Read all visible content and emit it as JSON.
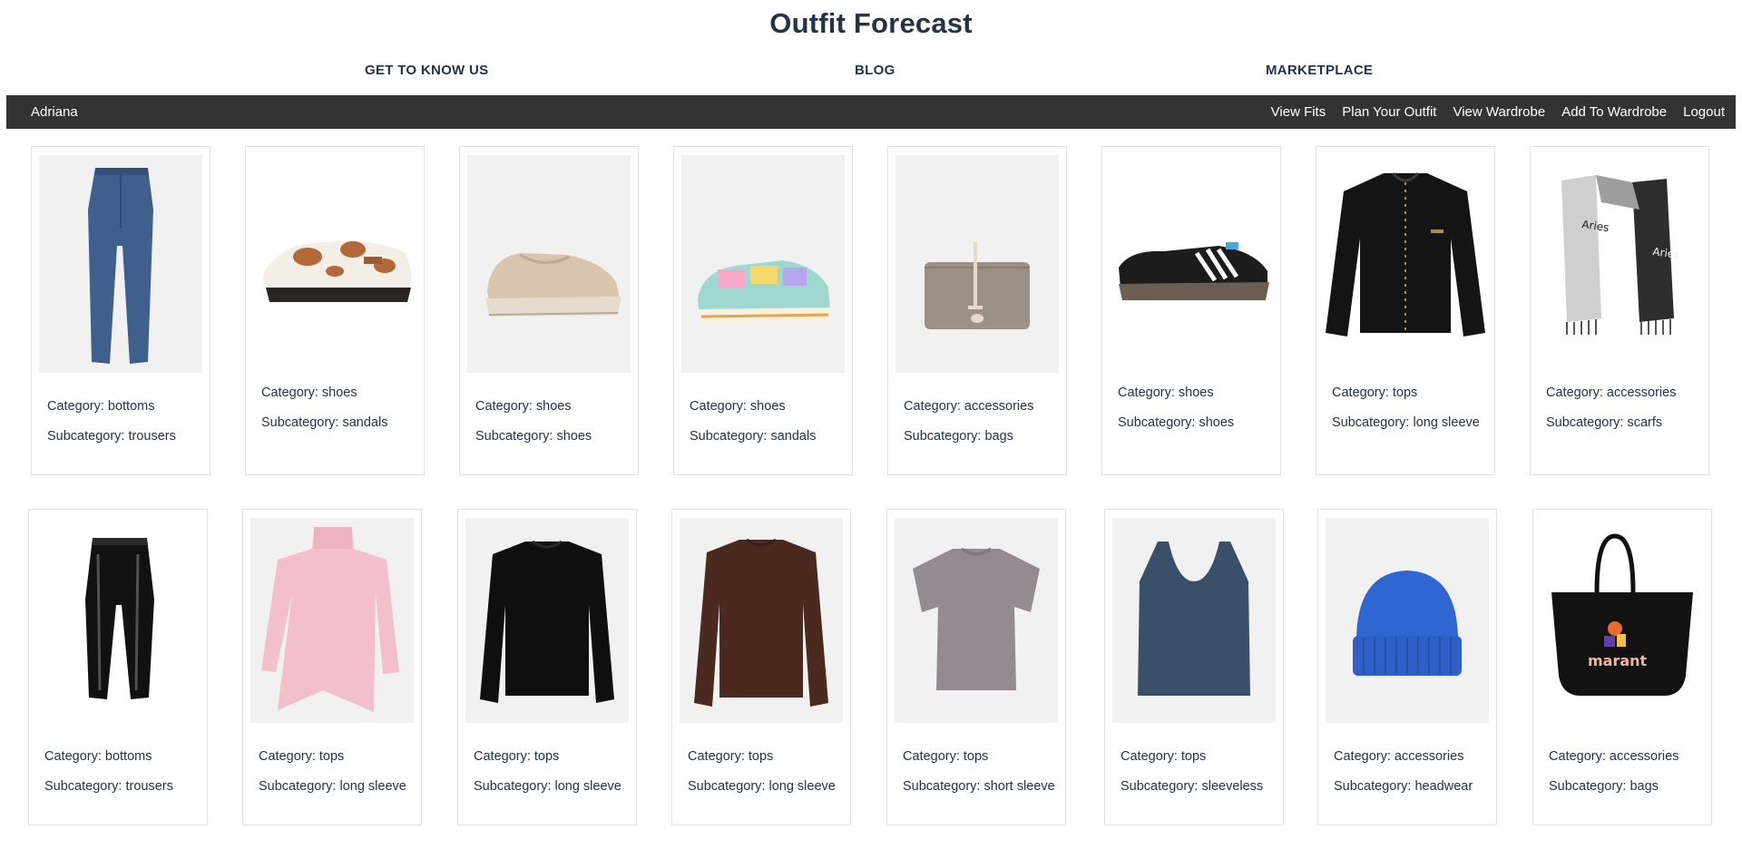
{
  "app": {
    "title": "Outfit Forecast"
  },
  "topnav": {
    "about": "GET TO KNOW US",
    "blog": "BLOG",
    "marketplace": "MARKETPLACE"
  },
  "appbar": {
    "user": "Adriana",
    "links": [
      "View Fits",
      "Plan Your Outfit",
      "View Wardrobe",
      "Add To Wardrobe",
      "Logout"
    ]
  },
  "items": [
    {
      "category": "Category: bottoms",
      "subcategory": "Subcategory: trousers",
      "icon": "jeans-icon"
    },
    {
      "category": "Category: shoes",
      "subcategory": "Subcategory: sandals",
      "icon": "cow-print-clog-icon"
    },
    {
      "category": "Category: shoes",
      "subcategory": "Subcategory: shoes",
      "icon": "loafer-icon"
    },
    {
      "category": "Category: shoes",
      "subcategory": "Subcategory: sandals",
      "icon": "rainbow-sneaker-icon"
    },
    {
      "category": "Category: accessories",
      "subcategory": "Subcategory: bags",
      "icon": "clutch-bag-icon"
    },
    {
      "category": "Category: shoes",
      "subcategory": "Subcategory: shoes",
      "icon": "black-sneaker-icon"
    },
    {
      "category": "Category: tops",
      "subcategory": "Subcategory: long sleeve",
      "icon": "black-cardigan-icon"
    },
    {
      "category": "Category: accessories",
      "subcategory": "Subcategory: scarfs",
      "icon": "scarf-icon"
    },
    {
      "category": "Category: bottoms",
      "subcategory": "Subcategory: trousers",
      "icon": "vinyl-trousers-icon"
    },
    {
      "category": "Category: tops",
      "subcategory": "Subcategory: long sleeve",
      "icon": "pink-sweater-icon"
    },
    {
      "category": "Category: tops",
      "subcategory": "Subcategory: long sleeve",
      "icon": "black-sweatshirt-icon"
    },
    {
      "category": "Category: tops",
      "subcategory": "Subcategory: long sleeve",
      "icon": "brown-sweatshirt-icon"
    },
    {
      "category": "Category: tops",
      "subcategory": "Subcategory: short sleeve",
      "icon": "tshirt-icon"
    },
    {
      "category": "Category: tops",
      "subcategory": "Subcategory: sleeveless",
      "icon": "tank-top-icon"
    },
    {
      "category": "Category: accessories",
      "subcategory": "Subcategory: headwear",
      "icon": "beanie-icon"
    },
    {
      "category": "Category: accessories",
      "subcategory": "Subcategory: bags",
      "icon": "tote-bag-icon"
    }
  ],
  "scarf_text": "Aries",
  "tote_logo": "marant",
  "colors": {
    "header_bg": "#333333",
    "text": "#243447",
    "card_border": "#e3e3e3",
    "image_bg": "#f1f1f1"
  }
}
